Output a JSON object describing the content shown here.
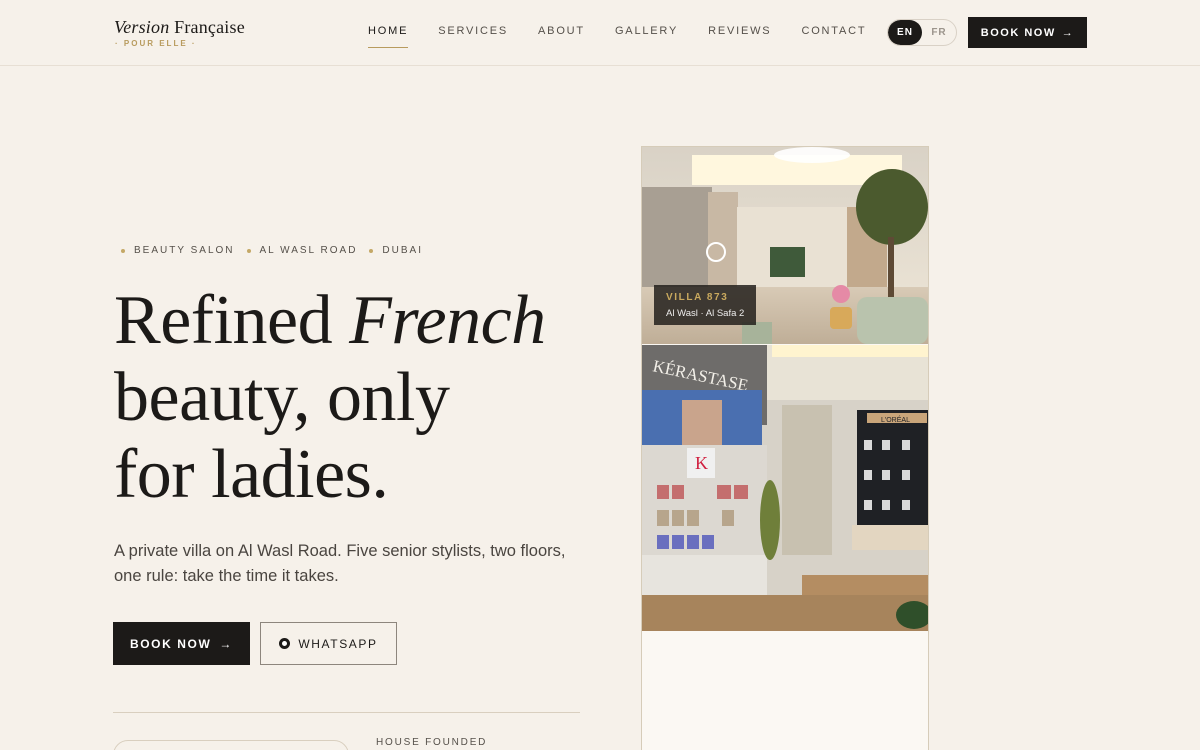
{
  "header": {
    "logo_main_a": "Version",
    "logo_main_b": "Française",
    "logo_sub": "· POUR ELLE ·",
    "nav": [
      {
        "label": "HOME",
        "active": true
      },
      {
        "label": "SERVICES"
      },
      {
        "label": "ABOUT"
      },
      {
        "label": "GALLERY"
      },
      {
        "label": "REVIEWS"
      },
      {
        "label": "CONTACT"
      }
    ],
    "lang_en": "EN",
    "lang_fr": "FR",
    "book_label": "BOOK NOW",
    "book_arrow": "→"
  },
  "hero": {
    "tags": [
      "BEAUTY SALON",
      "AL WASL ROAD",
      "DUBAI"
    ],
    "headline_1": "Refined",
    "headline_1_italic": "French",
    "headline_2": "beauty, only",
    "headline_3": "for ladies.",
    "lead": "A private villa on Al Wasl Road. Five senior stylists, two floors, one rule: take the time it takes.",
    "book_label": "BOOK NOW",
    "book_arrow": "→",
    "whatsapp_label": "WHATSAPP",
    "founded_label": "HOUSE FOUNDED"
  },
  "gallery": {
    "caption_title": "VILLA 873",
    "caption_sub": "Al Wasl · Al Safa 2",
    "top_sign": "KÉRASTASE",
    "loreal_sign": "L'ORÉAL"
  },
  "colors": {
    "background": "#f6f1ea",
    "ink": "#1c1a18",
    "gold": "#b89b5e"
  }
}
